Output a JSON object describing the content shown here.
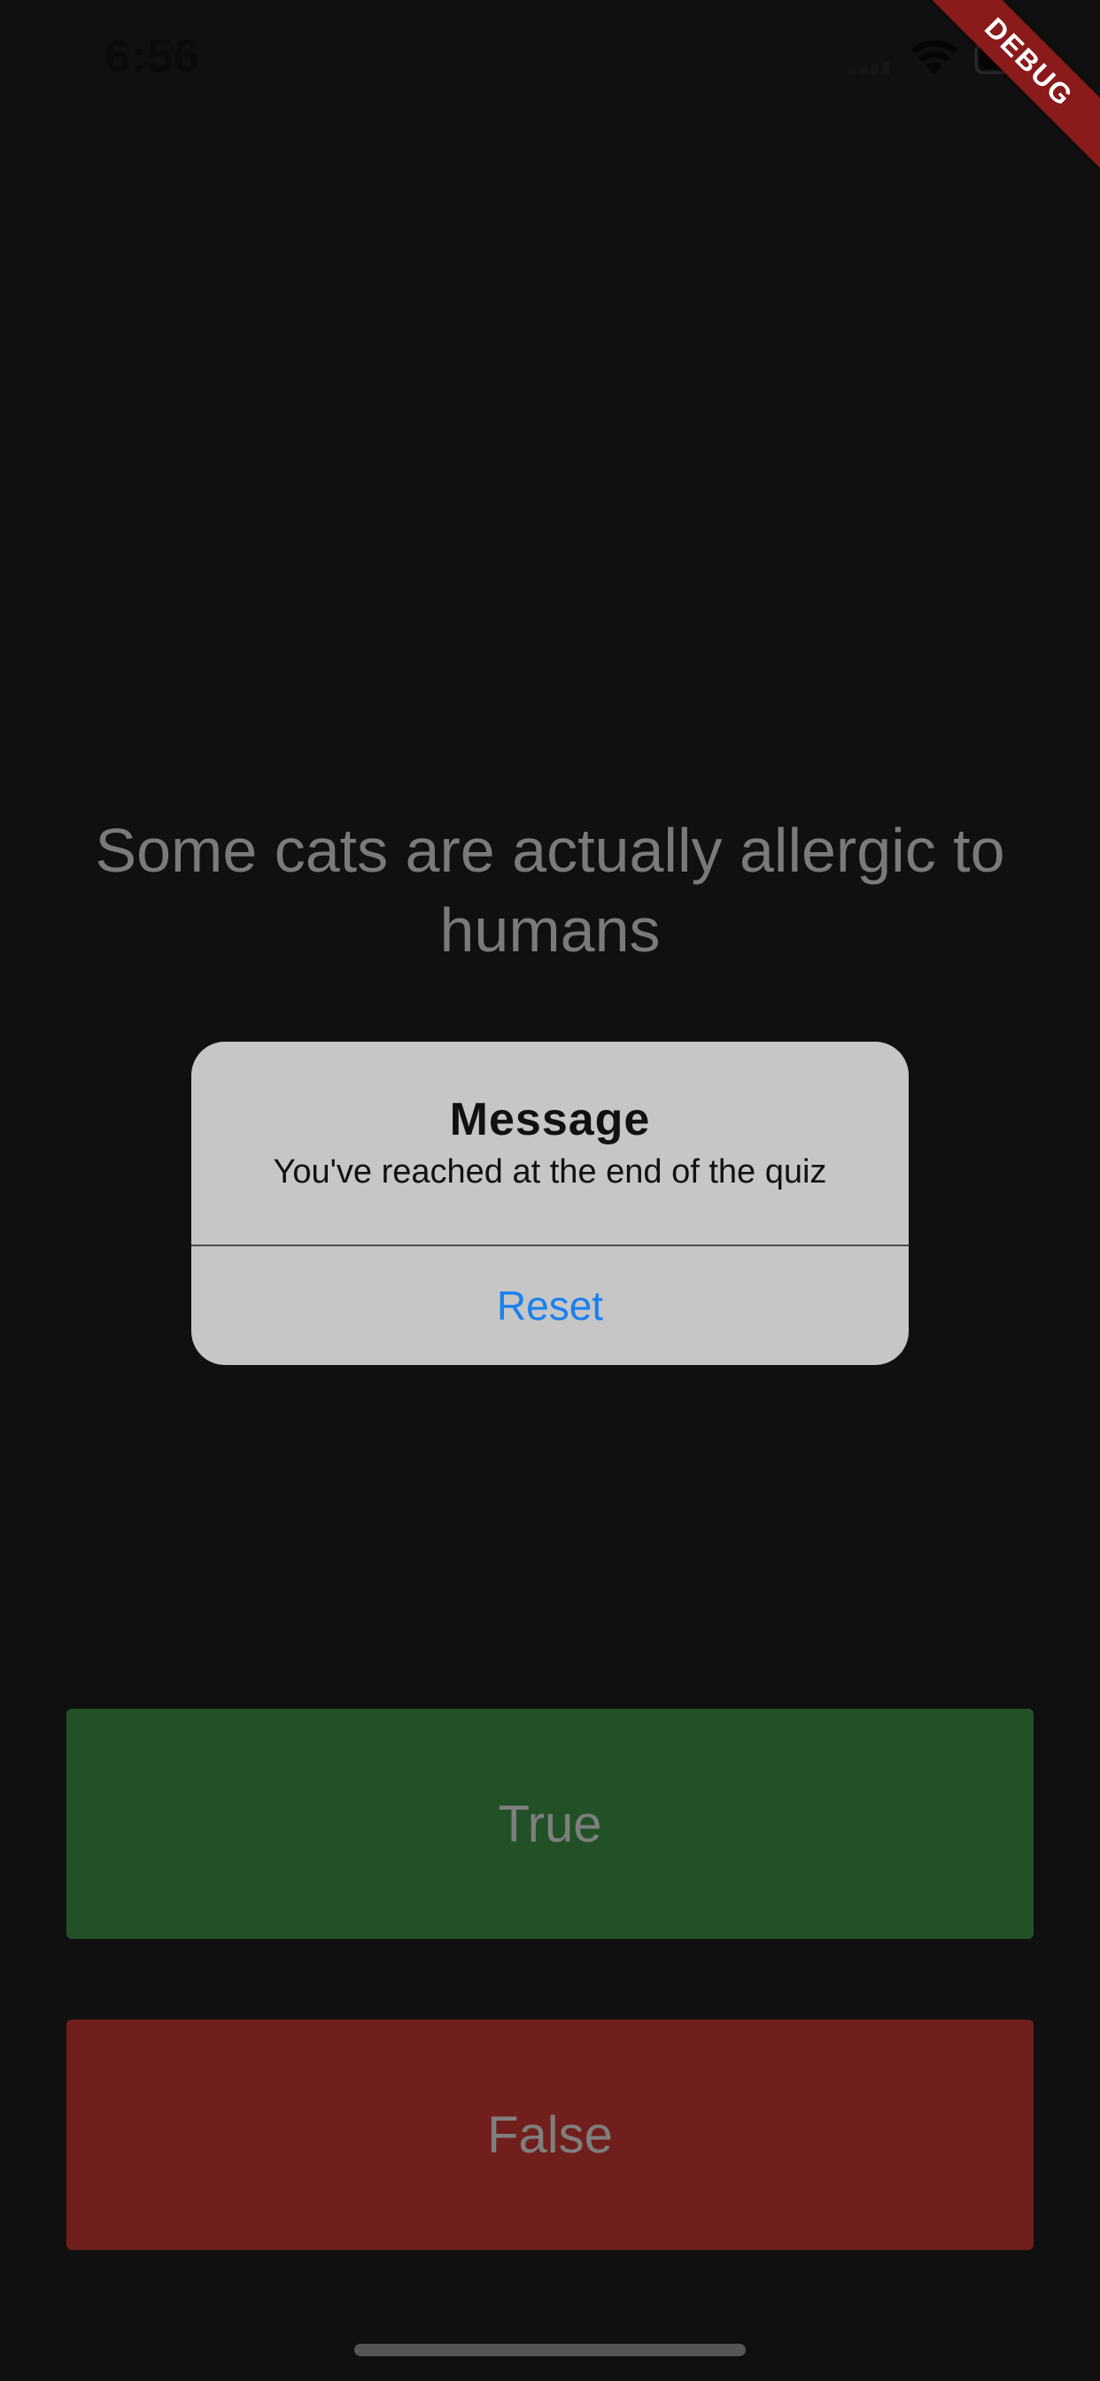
{
  "status_bar": {
    "time": "6:56",
    "icons": [
      "signal-icon",
      "wifi-icon",
      "battery-icon"
    ]
  },
  "debug_banner": {
    "label": "DEBUG",
    "color": "#8b1a1a"
  },
  "question": {
    "text": "Some cats are actually allergic to humans"
  },
  "dialog": {
    "title": "Message",
    "message": "You've reached at the end of the quiz",
    "action_label": "Reset",
    "action_color": "#1a80f0"
  },
  "buttons": {
    "true_label": "True",
    "true_color": "#235127",
    "false_label": "False",
    "false_color": "#711f1c"
  }
}
